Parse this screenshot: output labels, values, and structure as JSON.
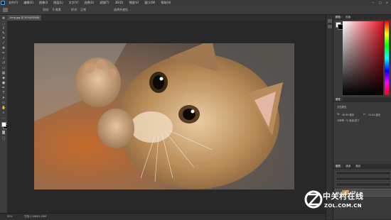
{
  "menubar": {
    "items": [
      "文件(F)",
      "编辑(E)",
      "图像(I)",
      "图层(L)",
      "文字(Y)",
      "选择(S)",
      "滤镜(T)",
      "3D(D)",
      "视图(V)",
      "窗口(W)",
      "帮助(H)"
    ],
    "window_controls": [
      "—",
      "□",
      "✕"
    ]
  },
  "optionsbar": {
    "label1": "羽化:",
    "value1": "0 像素",
    "label2": "样式:",
    "value2": "正常",
    "button": "选择并遮住..."
  },
  "document": {
    "tab_title": "1img.jpg @ 50%(RGB/8)",
    "zoom": "50%",
    "status_info": "文档:1.49M/1.49M"
  },
  "panel": {
    "tabs_top": [
      "颜色",
      "色板"
    ],
    "properties_tab": "属性",
    "properties_title": "文档属性",
    "prop_w_label": "W:",
    "prop_w": "48.89 厘米",
    "prop_h_label": "H:",
    "prop_h": "24.00 厘米",
    "prop_res": "分辨率: 72 像素/英寸",
    "layers_tabs": [
      "图层",
      "通道",
      "路径"
    ],
    "layer_name": "背景"
  },
  "watermark": {
    "cn": "中关村在线",
    "en": "ZOL.COM.CN"
  },
  "colors": {
    "accent": "#31a8ff",
    "photo_warm": "#c8955a"
  }
}
